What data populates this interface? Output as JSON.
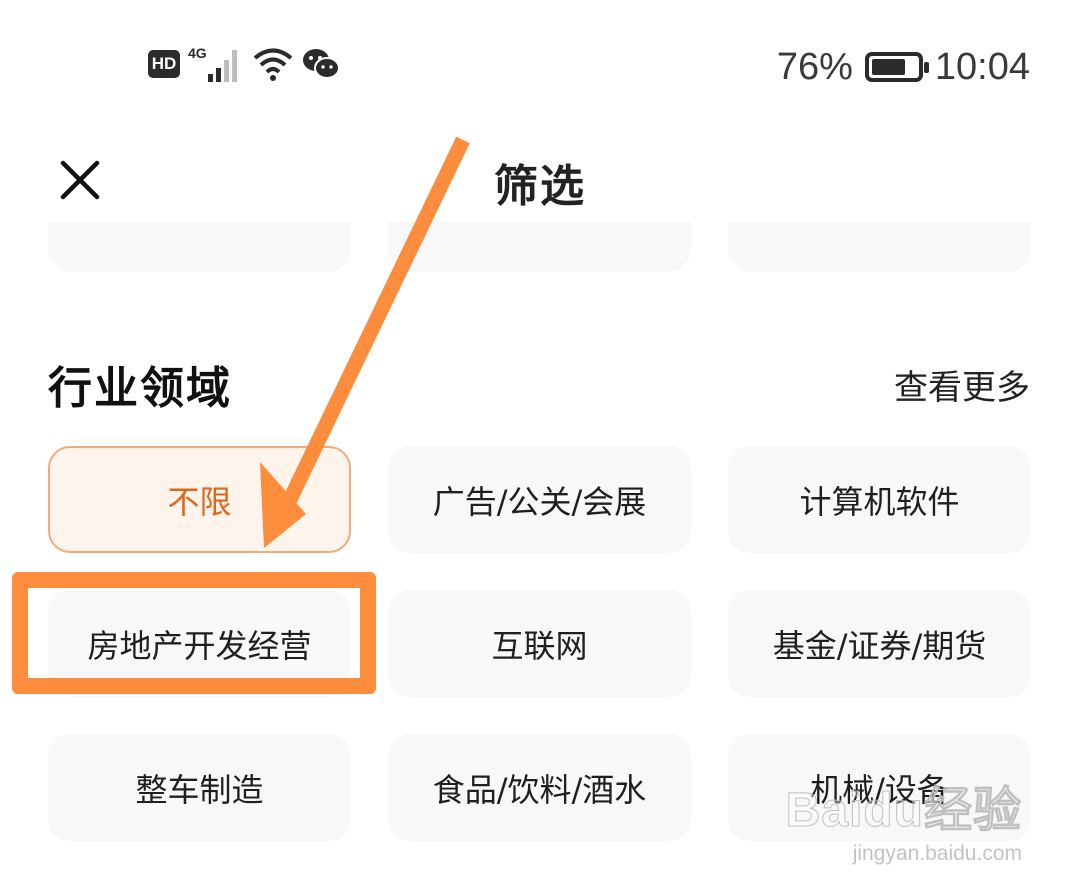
{
  "status_bar": {
    "hd_label": "HD",
    "network_label": "4G",
    "battery_text": "76%",
    "battery_level": 0.76,
    "time": "10:04",
    "icons": [
      "hd-badge",
      "signal-icon",
      "wifi-icon",
      "wechat-icon",
      "battery-icon"
    ]
  },
  "header": {
    "title": "筛选",
    "close_icon": "close-icon"
  },
  "industry": {
    "title": "行业领域",
    "see_more": "查看更多",
    "options": [
      {
        "label": "不限",
        "selected": true
      },
      {
        "label": "广告/公关/会展",
        "selected": false
      },
      {
        "label": "计算机软件",
        "selected": false
      },
      {
        "label": "房地产开发经营",
        "selected": false
      },
      {
        "label": "互联网",
        "selected": false
      },
      {
        "label": "基金/证券/期货",
        "selected": false
      },
      {
        "label": "整车制造",
        "selected": false
      },
      {
        "label": "食品/饮料/酒水",
        "selected": false
      },
      {
        "label": "机械/设备",
        "selected": false
      }
    ]
  },
  "annotation": {
    "arrow_color": "#fb8d3c",
    "highlight_color": "#fb8d3c"
  },
  "watermark": {
    "logo": "Baidu经验",
    "url": "jingyan.baidu.com"
  },
  "colors": {
    "selected_text": "#e0661c",
    "selected_bg": "#fff4ec",
    "selected_border": "#f0ab7a",
    "chip_bg": "#f7f8fa"
  }
}
